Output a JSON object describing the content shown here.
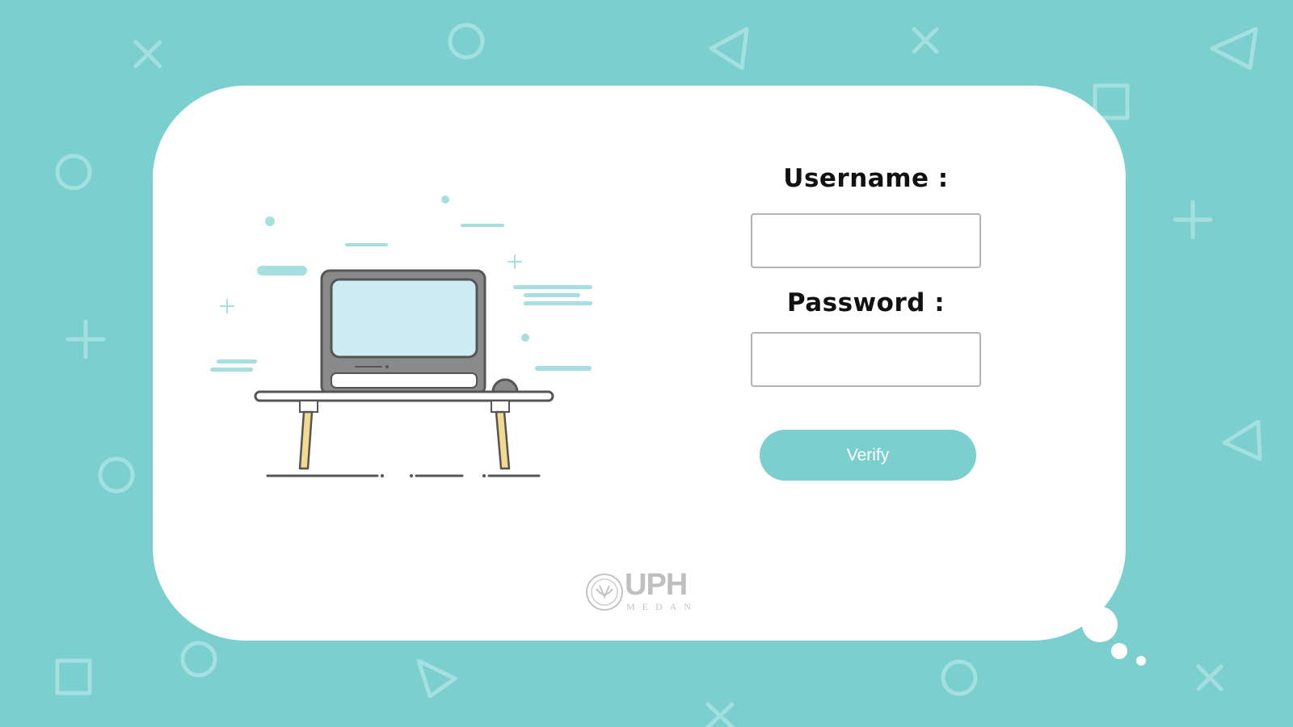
{
  "colors": {
    "background": "#7bcfcf",
    "card": "#ffffff",
    "accent": "#7bcfcf",
    "input_border": "#b4b4b4",
    "label_text": "#111111",
    "button_text": "#ffffff"
  },
  "login": {
    "username_label": "Username :",
    "username_value": "",
    "password_label": "Password :",
    "password_value": "",
    "verify_label": "Verify"
  },
  "logo": {
    "text": "UPH",
    "subtext": "MEDAN"
  },
  "icons": {
    "illustration": "laptop-on-table-illustration",
    "logo_seal": "university-seal-icon",
    "background_shapes": [
      "cross-icon",
      "circle-icon",
      "triangle-icon",
      "square-icon",
      "plus-icon"
    ]
  }
}
